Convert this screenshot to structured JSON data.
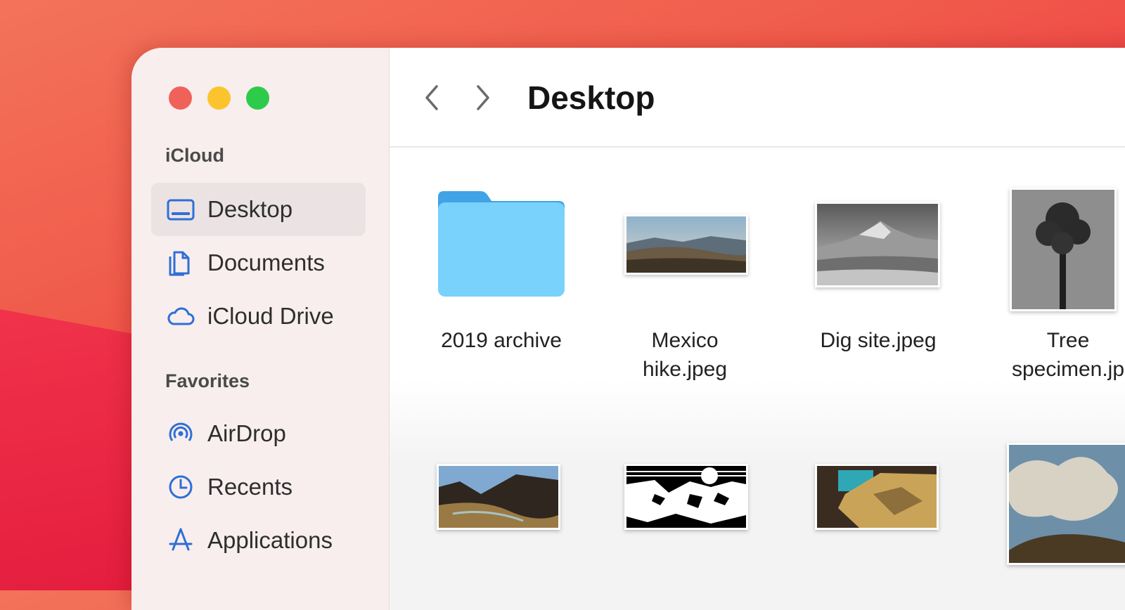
{
  "window": {
    "traffic_lights": {
      "close_color": "#f06259",
      "minimize_color": "#fbc42e",
      "maximize_color": "#2ecb4b"
    }
  },
  "sidebar": {
    "sections": [
      {
        "title": "iCloud",
        "items": [
          {
            "label": "Desktop",
            "icon": "desktop-icon",
            "selected": true
          },
          {
            "label": "Documents",
            "icon": "documents-icon",
            "selected": false
          },
          {
            "label": "iCloud Drive",
            "icon": "cloud-icon",
            "selected": false
          }
        ]
      },
      {
        "title": "Favorites",
        "items": [
          {
            "label": "AirDrop",
            "icon": "airdrop-icon",
            "selected": false
          },
          {
            "label": "Recents",
            "icon": "clock-icon",
            "selected": false
          },
          {
            "label": "Applications",
            "icon": "applications-icon",
            "selected": false
          }
        ]
      }
    ],
    "accent_color": "#2f6fd6"
  },
  "toolbar": {
    "back_icon": "chevron-left-icon",
    "forward_icon": "chevron-right-icon",
    "title": "Desktop"
  },
  "files": [
    {
      "name_line1": "2019 archive",
      "name_line2": "",
      "kind": "folder"
    },
    {
      "name_line1": "Mexico",
      "name_line2": "hike.jpeg",
      "kind": "image"
    },
    {
      "name_line1": "Dig site.jpeg",
      "name_line2": "",
      "kind": "image"
    },
    {
      "name_line1": "Tree",
      "name_line2": "specimen.jp",
      "kind": "image"
    },
    {
      "name_line1": "",
      "name_line2": "",
      "kind": "image"
    },
    {
      "name_line1": "",
      "name_line2": "",
      "kind": "image"
    },
    {
      "name_line1": "",
      "name_line2": "",
      "kind": "image"
    },
    {
      "name_line1": "",
      "name_line2": "",
      "kind": "image"
    }
  ]
}
